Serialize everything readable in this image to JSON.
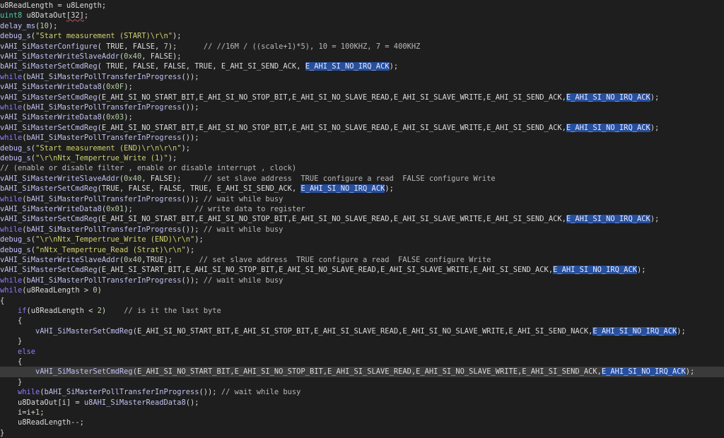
{
  "editor": {
    "current_line": 36,
    "lines": [
      [
        [
          "id",
          "u8ReadLength = u8Length;"
        ]
      ],
      [
        [
          "ty",
          "uint8"
        ],
        [
          "id",
          " u8DataOut"
        ],
        [
          "sq",
          "[32]"
        ],
        [
          "pu",
          ";"
        ]
      ],
      [
        [
          "fn",
          "delay_ms"
        ],
        [
          "pu",
          "("
        ],
        [
          "nm",
          "10"
        ],
        [
          "pu",
          ");"
        ]
      ],
      [
        [
          "fn",
          "debug_s"
        ],
        [
          "pu",
          "("
        ],
        [
          "st",
          "\"Start measurement (START)\\r\\n\""
        ],
        [
          "pu",
          ");"
        ]
      ],
      [
        [
          "ac",
          "vAHI_SiMasterConfigure"
        ],
        [
          "pu",
          "( "
        ],
        [
          "id",
          "TRUE"
        ],
        [
          "pu",
          ", "
        ],
        [
          "id",
          "FALSE"
        ],
        [
          "pu",
          ", "
        ],
        [
          "nm",
          "7"
        ],
        [
          "pu",
          ");      "
        ],
        [
          "cm",
          "// //16M / ((scale+1)*5), 10 = 100KHZ, 7 = 400KHZ"
        ]
      ],
      [
        [
          "ac",
          "vAHI_SiMasterWriteSlaveAddr"
        ],
        [
          "pu",
          "("
        ],
        [
          "nm",
          "0x40"
        ],
        [
          "pu",
          ", "
        ],
        [
          "id",
          "FALSE"
        ],
        [
          "pu",
          ");"
        ]
      ],
      [
        [
          "ac",
          "bAHI_SiMasterSetCmdReg"
        ],
        [
          "pu",
          "( "
        ],
        [
          "id",
          "TRUE"
        ],
        [
          "pu",
          ", "
        ],
        [
          "id",
          "FALSE"
        ],
        [
          "pu",
          ", "
        ],
        [
          "id",
          "FALSE"
        ],
        [
          "pu",
          ", "
        ],
        [
          "id",
          "TRUE"
        ],
        [
          "pu",
          ", "
        ],
        [
          "id",
          "E_AHI_SI_SEND_ACK"
        ],
        [
          "pu",
          ", "
        ],
        [
          "hl",
          "E_AHI_SI_NO_IRQ_ACK"
        ],
        [
          "pu",
          ");"
        ]
      ],
      [
        [
          "kw",
          "while"
        ],
        [
          "pu",
          "("
        ],
        [
          "ac",
          "bAHI_SiMasterPollTransferInProgress"
        ],
        [
          "pu",
          "());"
        ]
      ],
      [
        [
          "ac",
          "vAHI_SiMasterWriteData8"
        ],
        [
          "pu",
          "("
        ],
        [
          "nm",
          "0x0F"
        ],
        [
          "pu",
          ");"
        ]
      ],
      [
        [
          "ac",
          "vAHI_SiMasterSetCmdReg"
        ],
        [
          "pu",
          "("
        ],
        [
          "id",
          "E_AHI_SI_NO_START_BIT"
        ],
        [
          "pu",
          ","
        ],
        [
          "id",
          "E_AHI_SI_NO_STOP_BIT"
        ],
        [
          "pu",
          ","
        ],
        [
          "id",
          "E_AHI_SI_NO_SLAVE_READ"
        ],
        [
          "pu",
          ","
        ],
        [
          "id",
          "E_AHI_SI_SLAVE_WRITE"
        ],
        [
          "pu",
          ","
        ],
        [
          "id",
          "E_AHI_SI_SEND_ACK"
        ],
        [
          "pu",
          ","
        ],
        [
          "hl",
          "E_AHI_SI_NO_IRQ_ACK"
        ],
        [
          "pu",
          ");"
        ]
      ],
      [
        [
          "kw",
          "while"
        ],
        [
          "pu",
          "("
        ],
        [
          "ac",
          "bAHI_SiMasterPollTransferInProgress"
        ],
        [
          "pu",
          "());"
        ]
      ],
      [
        [
          "ac",
          "vAHI_SiMasterWriteData8"
        ],
        [
          "pu",
          "("
        ],
        [
          "nm",
          "0x03"
        ],
        [
          "pu",
          ");"
        ]
      ],
      [
        [
          "ac",
          "vAHI_SiMasterSetCmdReg"
        ],
        [
          "pu",
          "("
        ],
        [
          "id",
          "E_AHI_SI_NO_START_BIT"
        ],
        [
          "pu",
          ","
        ],
        [
          "id",
          "E_AHI_SI_NO_STOP_BIT"
        ],
        [
          "pu",
          ","
        ],
        [
          "id",
          "E_AHI_SI_NO_SLAVE_READ"
        ],
        [
          "pu",
          ","
        ],
        [
          "id",
          "E_AHI_SI_SLAVE_WRITE"
        ],
        [
          "pu",
          ","
        ],
        [
          "id",
          "E_AHI_SI_SEND_ACK"
        ],
        [
          "pu",
          ","
        ],
        [
          "hl",
          "E_AHI_SI_NO_IRQ_ACK"
        ],
        [
          "pu",
          ");"
        ]
      ],
      [
        [
          "kw",
          "while"
        ],
        [
          "pu",
          "("
        ],
        [
          "ac",
          "bAHI_SiMasterPollTransferInProgress"
        ],
        [
          "pu",
          "());"
        ]
      ],
      [
        [
          "fn",
          "debug_s"
        ],
        [
          "pu",
          "("
        ],
        [
          "st",
          "\"Start measurement (END)\\r\\n\\r\\n\""
        ],
        [
          "pu",
          ");"
        ]
      ],
      [
        [
          "fn",
          "debug_s"
        ],
        [
          "pu",
          "("
        ],
        [
          "st",
          "\"\\r\\nNtx_Tempertrue_Write (1)\""
        ],
        [
          "pu",
          ");"
        ]
      ],
      [
        [
          "cm",
          "// (enable or disable filter , enable or disable interrupt , clock)"
        ]
      ],
      [
        [
          "ac",
          "vAHI_SiMasterWriteSlaveAddr"
        ],
        [
          "pu",
          "("
        ],
        [
          "nm",
          "0x40"
        ],
        [
          "pu",
          ", "
        ],
        [
          "id",
          "FALSE"
        ],
        [
          "pu",
          ");     "
        ],
        [
          "cm",
          "// set slave address  TRUE configure a read  FALSE configure Write"
        ]
      ],
      [
        [
          "ac",
          "bAHI_SiMasterSetCmdReg"
        ],
        [
          "pu",
          "("
        ],
        [
          "id",
          "TRUE"
        ],
        [
          "pu",
          ", "
        ],
        [
          "id",
          "FALSE"
        ],
        [
          "pu",
          ", "
        ],
        [
          "id",
          "FALSE"
        ],
        [
          "pu",
          ", "
        ],
        [
          "id",
          "TRUE"
        ],
        [
          "pu",
          ", "
        ],
        [
          "id",
          "E_AHI_SI_SEND_ACK"
        ],
        [
          "pu",
          ", "
        ],
        [
          "hl",
          "E_AHI_SI_NO_IRQ_ACK"
        ],
        [
          "pu",
          ");"
        ]
      ],
      [
        [
          "kw",
          "while"
        ],
        [
          "pu",
          "("
        ],
        [
          "ac",
          "bAHI_SiMasterPollTransferInProgress"
        ],
        [
          "pu",
          "()); "
        ],
        [
          "cm",
          "// wait while busy"
        ]
      ],
      [
        [
          "ac",
          "vAHI_SiMasterWriteData8"
        ],
        [
          "pu",
          "("
        ],
        [
          "nm",
          "0x01"
        ],
        [
          "pu",
          ");              "
        ],
        [
          "cm",
          "// write data to register"
        ]
      ],
      [
        [
          "ac",
          "vAHI_SiMasterSetCmdReg"
        ],
        [
          "pu",
          "("
        ],
        [
          "id",
          "E_AHI_SI_NO_START_BIT"
        ],
        [
          "pu",
          ","
        ],
        [
          "id",
          "E_AHI_SI_NO_STOP_BIT"
        ],
        [
          "pu",
          ","
        ],
        [
          "id",
          "E_AHI_SI_NO_SLAVE_READ"
        ],
        [
          "pu",
          ","
        ],
        [
          "id",
          "E_AHI_SI_SLAVE_WRITE"
        ],
        [
          "pu",
          ","
        ],
        [
          "id",
          "E_AHI_SI_SEND_ACK"
        ],
        [
          "pu",
          ","
        ],
        [
          "hl",
          "E_AHI_SI_NO_IRQ_ACK"
        ],
        [
          "pu",
          ");"
        ]
      ],
      [
        [
          "kw",
          "while"
        ],
        [
          "pu",
          "("
        ],
        [
          "ac",
          "bAHI_SiMasterPollTransferInProgress"
        ],
        [
          "pu",
          "()); "
        ],
        [
          "cm",
          "// wait while busy"
        ]
      ],
      [
        [
          "fn",
          "debug_s"
        ],
        [
          "pu",
          "("
        ],
        [
          "st",
          "\"\\r\\nNtx_Tempertrue_Write (END)\\r\\n\""
        ],
        [
          "pu",
          ");"
        ]
      ],
      [
        [
          "fn",
          "debug_s"
        ],
        [
          "pu",
          "("
        ],
        [
          "st",
          "\"nNtx_Tempertrue_Read (Strat)\\r\\n\""
        ],
        [
          "pu",
          ");"
        ]
      ],
      [
        [
          "ac",
          "vAHI_SiMasterWriteSlaveAddr"
        ],
        [
          "pu",
          "("
        ],
        [
          "nm",
          "0x40"
        ],
        [
          "pu",
          ","
        ],
        [
          "id",
          "TRUE"
        ],
        [
          "pu",
          ");      "
        ],
        [
          "cm",
          "// set slave address  TRUE configure a read  FALSE configure Write"
        ]
      ],
      [
        [
          "ac",
          "vAHI_SiMasterSetCmdReg"
        ],
        [
          "pu",
          "("
        ],
        [
          "id",
          "E_AHI_SI_START_BIT"
        ],
        [
          "pu",
          ","
        ],
        [
          "id",
          "E_AHI_SI_NO_STOP_BIT"
        ],
        [
          "pu",
          ","
        ],
        [
          "id",
          "E_AHI_SI_NO_SLAVE_READ"
        ],
        [
          "pu",
          ","
        ],
        [
          "id",
          "E_AHI_SI_SLAVE_WRITE"
        ],
        [
          "pu",
          ","
        ],
        [
          "id",
          "E_AHI_SI_SEND_ACK"
        ],
        [
          "pu",
          ","
        ],
        [
          "hl",
          "E_AHI_SI_NO_IRQ_ACK"
        ],
        [
          "pu",
          ");"
        ]
      ],
      [
        [
          "kw",
          "while"
        ],
        [
          "pu",
          "("
        ],
        [
          "ac",
          "bAHI_SiMasterPollTransferInProgress"
        ],
        [
          "pu",
          "()); "
        ],
        [
          "cm",
          "// wait while busy"
        ]
      ],
      [
        [
          "kw",
          "while"
        ],
        [
          "pu",
          "(u8ReadLength > "
        ],
        [
          "nm",
          "0"
        ],
        [
          "pu",
          ")"
        ]
      ],
      [
        [
          "pu",
          "{"
        ]
      ],
      [
        [
          "pu",
          "    "
        ],
        [
          "kw",
          "if"
        ],
        [
          "pu",
          "(u8ReadLength < "
        ],
        [
          "nm",
          "2"
        ],
        [
          "pu",
          ")    "
        ],
        [
          "cm",
          "// is it the last byte"
        ]
      ],
      [
        [
          "pu",
          "    {"
        ]
      ],
      [
        [
          "pu",
          "        "
        ],
        [
          "ac",
          "vAHI_SiMasterSetCmdReg"
        ],
        [
          "pu",
          "("
        ],
        [
          "id",
          "E_AHI_SI_NO_START_BIT"
        ],
        [
          "pu",
          ","
        ],
        [
          "id",
          "E_AHI_SI_STOP_BIT"
        ],
        [
          "pu",
          ","
        ],
        [
          "id",
          "E_AHI_SI_SLAVE_READ"
        ],
        [
          "pu",
          ","
        ],
        [
          "id",
          "E_AHI_SI_NO_SLAVE_WRITE"
        ],
        [
          "pu",
          ","
        ],
        [
          "id",
          "E_AHI_SI_SEND_NACK"
        ],
        [
          "pu",
          ","
        ],
        [
          "hl",
          "E_AHI_SI_NO_IRQ_ACK"
        ],
        [
          "pu",
          ");"
        ]
      ],
      [
        [
          "pu",
          "    }"
        ]
      ],
      [
        [
          "pu",
          "    "
        ],
        [
          "kw",
          "else"
        ]
      ],
      [
        [
          "pu",
          "    {"
        ]
      ],
      [
        [
          "pu",
          "        "
        ],
        [
          "ac",
          "vAHI_SiMasterSetCmdReg"
        ],
        [
          "pu",
          "("
        ],
        [
          "id",
          "E_AHI_SI_NO_START_BIT"
        ],
        [
          "pu",
          ","
        ],
        [
          "id",
          "E_AHI_SI_NO_STOP_BIT"
        ],
        [
          "pu",
          ","
        ],
        [
          "id",
          "E_AHI_SI_SLAVE_READ"
        ],
        [
          "pu",
          ","
        ],
        [
          "id",
          "E_AHI_SI_NO_SLAVE_WRITE"
        ],
        [
          "pu",
          ","
        ],
        [
          "id",
          "E_AHI_SI_SEND_ACK"
        ],
        [
          "pu",
          ","
        ],
        [
          "hl",
          "E_AHI_SI_NO_IRQ_ACK"
        ],
        [
          "pu",
          ");"
        ]
      ],
      [
        [
          "pu",
          "    }"
        ]
      ],
      [
        [
          "pu",
          "    "
        ],
        [
          "kw",
          "while"
        ],
        [
          "pu",
          "("
        ],
        [
          "ac",
          "bAHI_SiMasterPollTransferInProgress"
        ],
        [
          "pu",
          "()); "
        ],
        [
          "cm",
          "// wait while busy"
        ]
      ],
      [
        [
          "pu",
          "    u8DataOut[i] = "
        ],
        [
          "ac",
          "u8AHI_SiMasterReadData8"
        ],
        [
          "pu",
          "();"
        ]
      ],
      [
        [
          "pu",
          "    i=i+"
        ],
        [
          "nm",
          "1"
        ],
        [
          "pu",
          ";"
        ]
      ],
      [
        [
          "pu",
          "    u8ReadLength--;"
        ]
      ],
      [
        [
          "pu",
          "}"
        ]
      ]
    ]
  }
}
